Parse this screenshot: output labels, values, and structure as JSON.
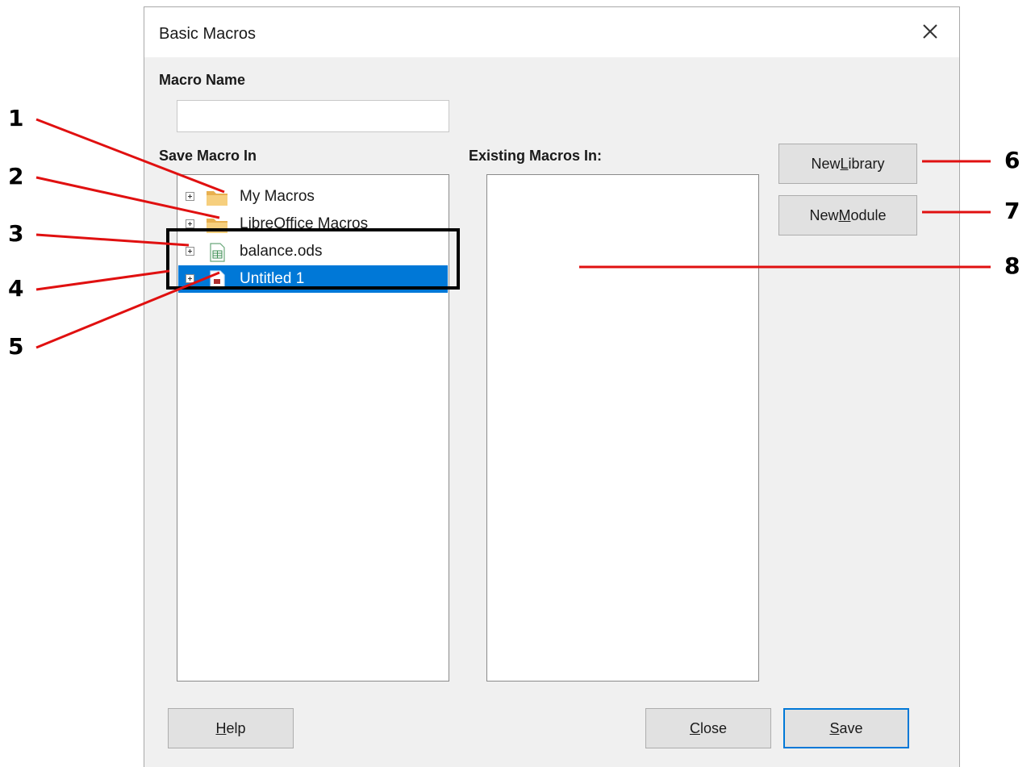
{
  "dialog": {
    "title": "Basic Macros",
    "close_symbol": "×"
  },
  "macro_name": {
    "label": "Macro Name",
    "value": ""
  },
  "save_macro_in": {
    "label": "Save Macro In",
    "items": [
      {
        "label": "My Macros",
        "icon": "folder-icon",
        "selected": false
      },
      {
        "label": "LibreOffice Macros",
        "icon": "folder-icon",
        "selected": false
      },
      {
        "label": "balance.ods",
        "icon": "spreadsheet-document-icon",
        "selected": false
      },
      {
        "label": "Untitled 1",
        "icon": "document-icon",
        "selected": true
      }
    ]
  },
  "existing_macros": {
    "label": "Existing Macros In:"
  },
  "buttons": {
    "new_library": {
      "pre": "New ",
      "mnemonic": "L",
      "post": "ibrary"
    },
    "new_module": {
      "pre": "New ",
      "mnemonic": "M",
      "post": "odule"
    },
    "help": {
      "pre": "",
      "mnemonic": "H",
      "post": "elp"
    },
    "close": {
      "pre": "",
      "mnemonic": "C",
      "post": "lose"
    },
    "save": {
      "pre": "",
      "mnemonic": "S",
      "post": "ave"
    }
  },
  "callouts": [
    "1",
    "2",
    "3",
    "4",
    "5",
    "6",
    "7",
    "8"
  ],
  "colors": {
    "selection": "#0078d7",
    "callout_line": "#e01010",
    "folder": "#f2c46d"
  }
}
